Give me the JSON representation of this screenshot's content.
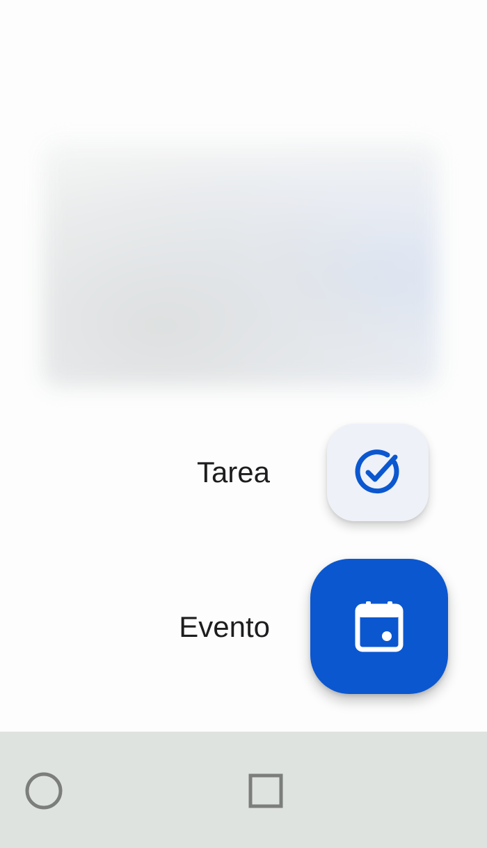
{
  "speed_dial": {
    "items": [
      {
        "label": "Tarea",
        "icon": "task-check-icon"
      },
      {
        "label": "Evento",
        "icon": "calendar-event-icon"
      }
    ]
  },
  "colors": {
    "primary": "#0b57d0",
    "mini_fab_bg": "#eef1f7",
    "nav_bar_bg": "#dfe3df",
    "nav_icon": "#7b7e7b",
    "label_text": "#1d1d1f"
  },
  "nav_bar": {
    "buttons": [
      {
        "icon": "home-circle-icon"
      },
      {
        "icon": "recents-square-icon"
      }
    ]
  }
}
